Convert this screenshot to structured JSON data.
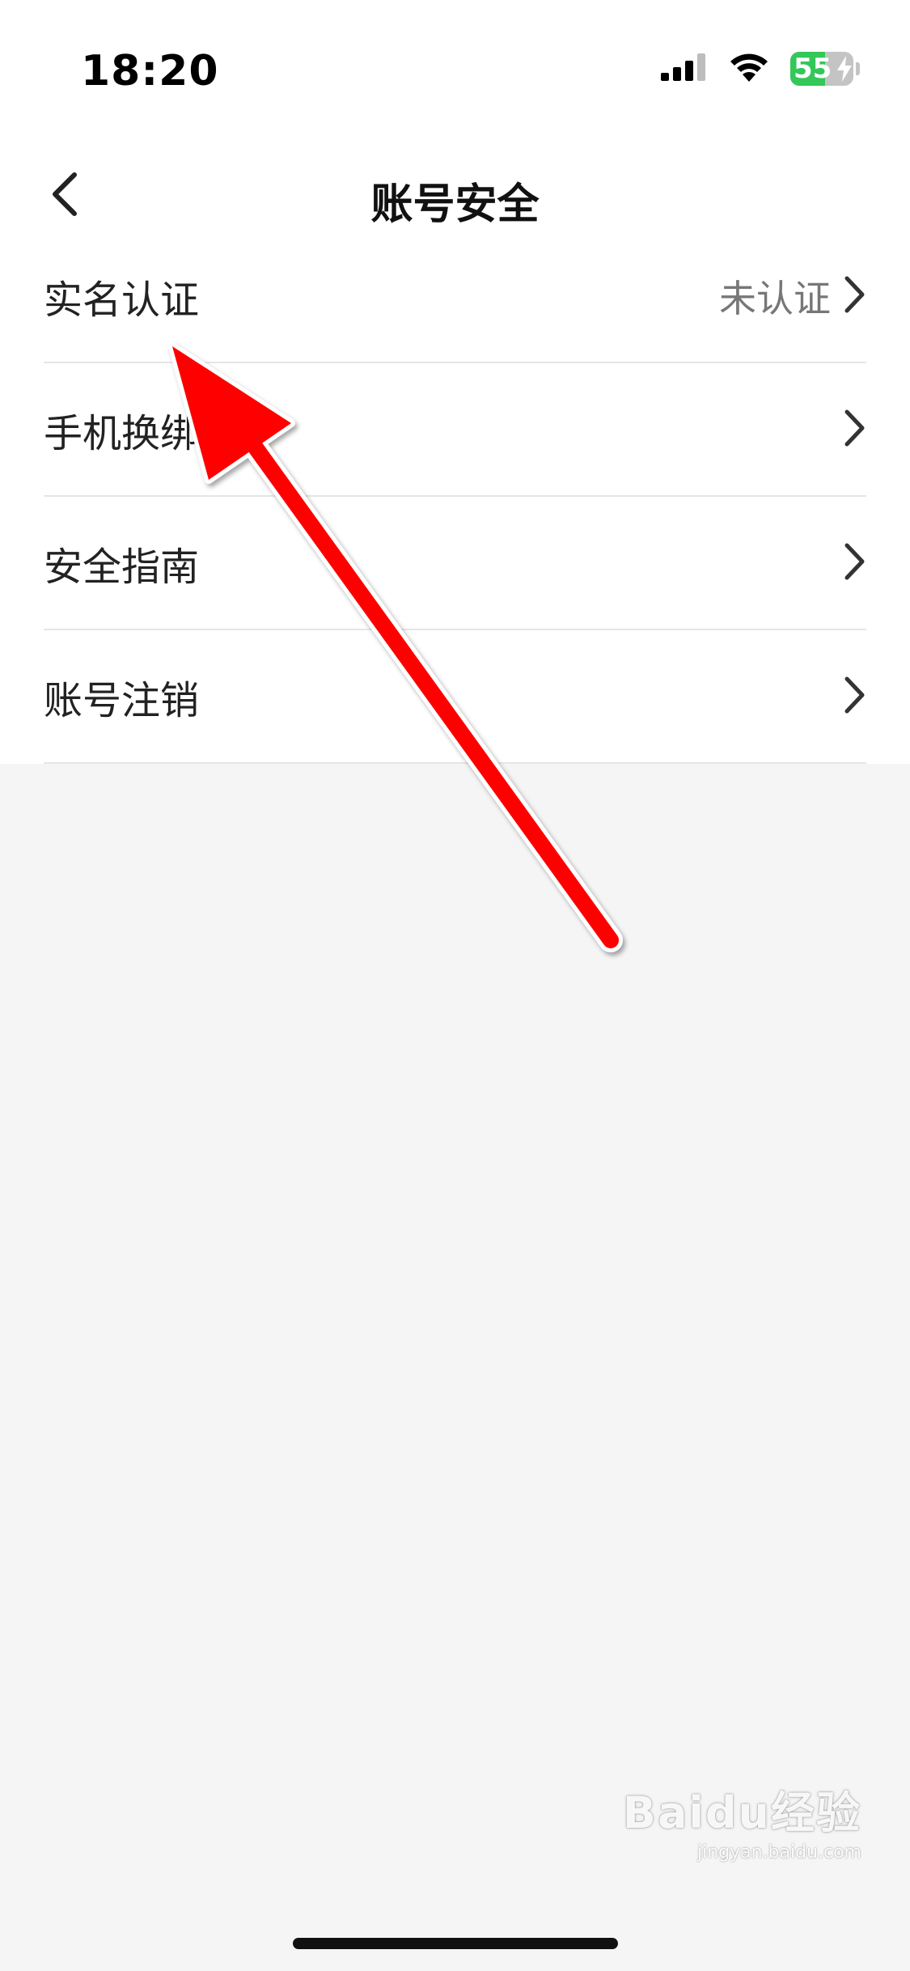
{
  "status_bar": {
    "time": "18:20",
    "battery": {
      "level_percent": 55,
      "label": "55",
      "charging": true,
      "fill_color": "#34c759"
    },
    "icons": [
      "signal-icon",
      "wifi-icon",
      "battery-icon",
      "charging-bolt-icon"
    ]
  },
  "nav": {
    "title": "账号安全",
    "back_icon": "chevron-left-icon"
  },
  "settings": {
    "items": [
      {
        "label": "实名认证",
        "value": "未认证"
      },
      {
        "label": "手机换绑",
        "value": ""
      },
      {
        "label": "安全指南",
        "value": ""
      },
      {
        "label": "账号注销",
        "value": ""
      }
    ],
    "row_icon": "chevron-right-icon"
  },
  "annotation": {
    "arrow_color": "#ff0000"
  },
  "watermark": {
    "logo": "Baidu经验",
    "url": "jingyan.baidu.com"
  }
}
